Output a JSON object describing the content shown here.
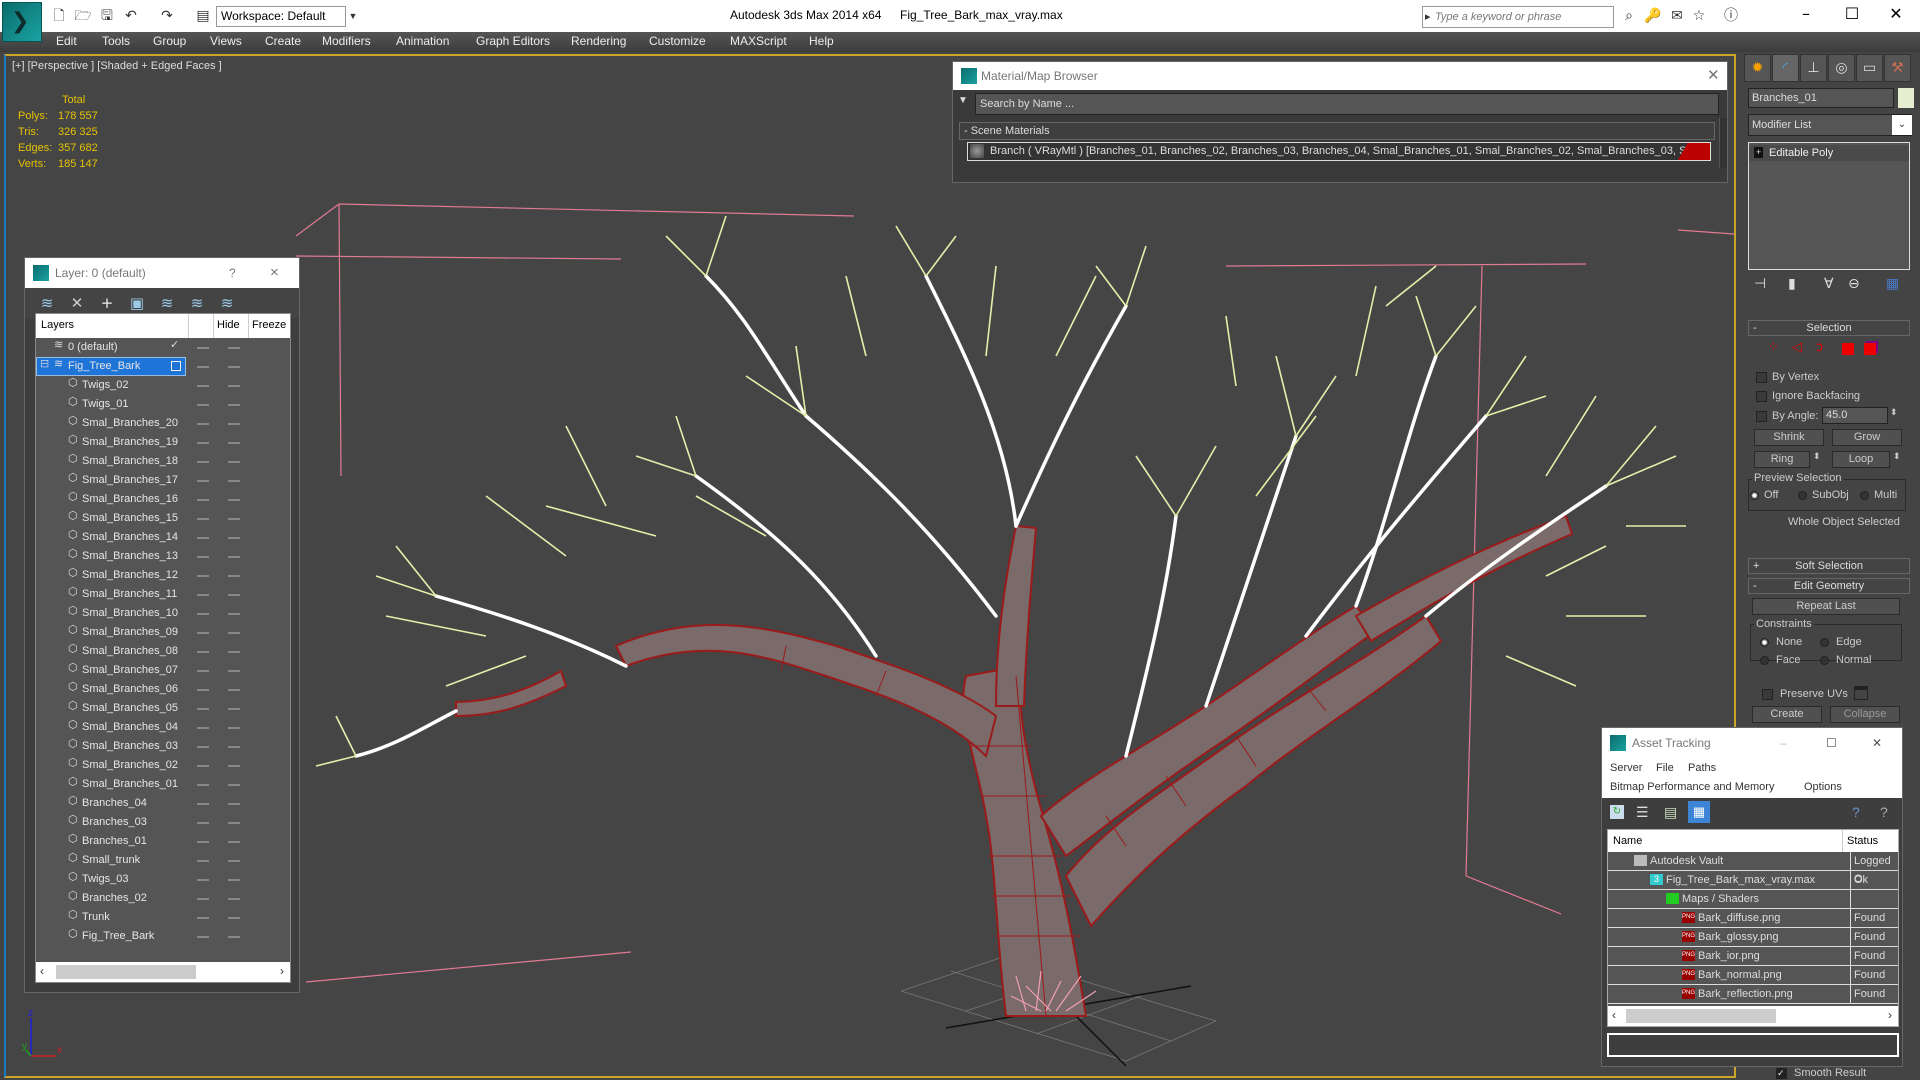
{
  "app": {
    "title": "Autodesk 3ds Max  2014 x64",
    "file": "Fig_Tree_Bark_max_vray.max",
    "workspace": "Workspace: Default",
    "search_placeholder": "Type a keyword or phrase",
    "window_controls": [
      "minimize",
      "maximize",
      "close"
    ]
  },
  "menu": [
    "Edit",
    "Tools",
    "Group",
    "Views",
    "Create",
    "Modifiers",
    "Animation",
    "Graph Editors",
    "Rendering",
    "Customize",
    "MAXScript",
    "Help"
  ],
  "viewport": {
    "label": "[+] [Perspective ] [Shaded + Edged Faces ]",
    "stats": {
      "header": "Total",
      "rows": [
        {
          "label": "Polys:",
          "value": "178 557"
        },
        {
          "label": "Tris:",
          "value": "326 325"
        },
        {
          "label": "Edges:",
          "value": "357 682"
        },
        {
          "label": "Verts:",
          "value": "185 147"
        }
      ]
    },
    "axis": {
      "x": "x",
      "y": "y",
      "z": "z"
    },
    "colors": {
      "trunk_wire": "#9b1a1a",
      "twig_wire": "#e8efb0",
      "branch_white": "#ffffff",
      "background": "#454545"
    }
  },
  "layer_manager": {
    "title": "Layer: 0 (default)",
    "help": "?",
    "close": "×",
    "columns": [
      "Layers",
      "Hide",
      "Freeze"
    ],
    "rows": [
      {
        "name": "0 (default)",
        "type": "layer",
        "current": true
      },
      {
        "name": "Fig_Tree_Bark",
        "type": "layer",
        "selected": true,
        "expanded": true
      },
      {
        "name": "Twigs_02",
        "type": "object"
      },
      {
        "name": "Twigs_01",
        "type": "object"
      },
      {
        "name": "Smal_Branches_20",
        "type": "object"
      },
      {
        "name": "Smal_Branches_19",
        "type": "object"
      },
      {
        "name": "Smal_Branches_18",
        "type": "object"
      },
      {
        "name": "Smal_Branches_17",
        "type": "object"
      },
      {
        "name": "Smal_Branches_16",
        "type": "object"
      },
      {
        "name": "Smal_Branches_15",
        "type": "object"
      },
      {
        "name": "Smal_Branches_14",
        "type": "object"
      },
      {
        "name": "Smal_Branches_13",
        "type": "object"
      },
      {
        "name": "Smal_Branches_12",
        "type": "object"
      },
      {
        "name": "Smal_Branches_11",
        "type": "object"
      },
      {
        "name": "Smal_Branches_10",
        "type": "object"
      },
      {
        "name": "Smal_Branches_09",
        "type": "object"
      },
      {
        "name": "Smal_Branches_08",
        "type": "object"
      },
      {
        "name": "Smal_Branches_07",
        "type": "object"
      },
      {
        "name": "Smal_Branches_06",
        "type": "object"
      },
      {
        "name": "Smal_Branches_05",
        "type": "object"
      },
      {
        "name": "Smal_Branches_04",
        "type": "object"
      },
      {
        "name": "Smal_Branches_03",
        "type": "object"
      },
      {
        "name": "Smal_Branches_02",
        "type": "object"
      },
      {
        "name": "Smal_Branches_01",
        "type": "object"
      },
      {
        "name": "Branches_04",
        "type": "object"
      },
      {
        "name": "Branches_03",
        "type": "object"
      },
      {
        "name": "Branches_01",
        "type": "object"
      },
      {
        "name": "Small_trunk",
        "type": "object"
      },
      {
        "name": "Twigs_03",
        "type": "object"
      },
      {
        "name": "Branches_02",
        "type": "object"
      },
      {
        "name": "Trunk",
        "type": "object"
      },
      {
        "name": "Fig_Tree_Bark",
        "type": "object"
      }
    ]
  },
  "material_browser": {
    "title": "Material/Map Browser",
    "search_placeholder": "Search by Name ...",
    "section": "- Scene Materials",
    "item": "Branch  ( VRayMtl )  [Branches_01, Branches_02, Branches_03, Branches_04, Smal_Branches_01, Smal_Branches_02, Smal_Branches_03, S...",
    "item_tail": ", S..."
  },
  "command_panel": {
    "object_name": "Branches_01",
    "object_color": "#e6eed0",
    "modifier_list": "Modifier List",
    "stack": [
      "Editable Poly"
    ],
    "selection": {
      "title": "Selection",
      "by_vertex": "By Vertex",
      "ignore_backfacing": "Ignore Backfacing",
      "by_angle": "By Angle:",
      "angle_value": "45.0",
      "shrink": "Shrink",
      "grow": "Grow",
      "ring": "Ring",
      "loop": "Loop",
      "preview_title": "Preview Selection",
      "preview_options": [
        "Off",
        "SubObj",
        "Multi"
      ],
      "preview_selected": "Off",
      "status": "Whole Object Selected"
    },
    "soft_selection": "Soft Selection",
    "edit_geometry": {
      "title": "Edit Geometry",
      "repeat_last": "Repeat Last",
      "constraints_title": "Constraints",
      "constraints": [
        "None",
        "Edge",
        "Face",
        "Normal"
      ],
      "constraint_selected": "None",
      "preserve_uvs": "Preserve UVs",
      "create": "Create",
      "collapse": "Collapse",
      "smooth_result": "Smooth Result"
    }
  },
  "asset_tracking": {
    "title": "Asset Tracking",
    "menu_row1": [
      "Server",
      "File",
      "Paths"
    ],
    "menu_row2": [
      "Bitmap Performance and Memory",
      "Options"
    ],
    "columns": [
      "Name",
      "Status"
    ],
    "rows": [
      {
        "name": "Autodesk Vault",
        "status": "Logged O",
        "level": 1,
        "icon": "vault"
      },
      {
        "name": "Fig_Tree_Bark_max_vray.max",
        "status": "Ok",
        "level": 2,
        "icon": "max"
      },
      {
        "name": "Maps / Shaders",
        "status": "",
        "level": 3,
        "icon": "maps"
      },
      {
        "name": "Bark_diffuse.png",
        "status": "Found",
        "level": 4,
        "icon": "png"
      },
      {
        "name": "Bark_glossy.png",
        "status": "Found",
        "level": 4,
        "icon": "png"
      },
      {
        "name": "Bark_ior.png",
        "status": "Found",
        "level": 4,
        "icon": "png"
      },
      {
        "name": "Bark_normal.png",
        "status": "Found",
        "level": 4,
        "icon": "png"
      },
      {
        "name": "Bark_reflection.png",
        "status": "Found",
        "level": 4,
        "icon": "png"
      }
    ]
  }
}
